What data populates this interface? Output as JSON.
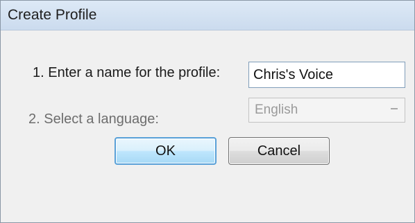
{
  "dialog": {
    "title": "Create Profile",
    "name_label": "1. Enter a name for the profile:",
    "name_value": "Chris's Voice",
    "language_label": "2. Select a language:",
    "language_value": "English",
    "ok_label": "OK",
    "cancel_label": "Cancel"
  },
  "colors": {
    "titlebar": "#cbdbee",
    "ok_border": "#58a0d8"
  },
  "icons": {
    "dropdown": "chevron-down-icon"
  }
}
